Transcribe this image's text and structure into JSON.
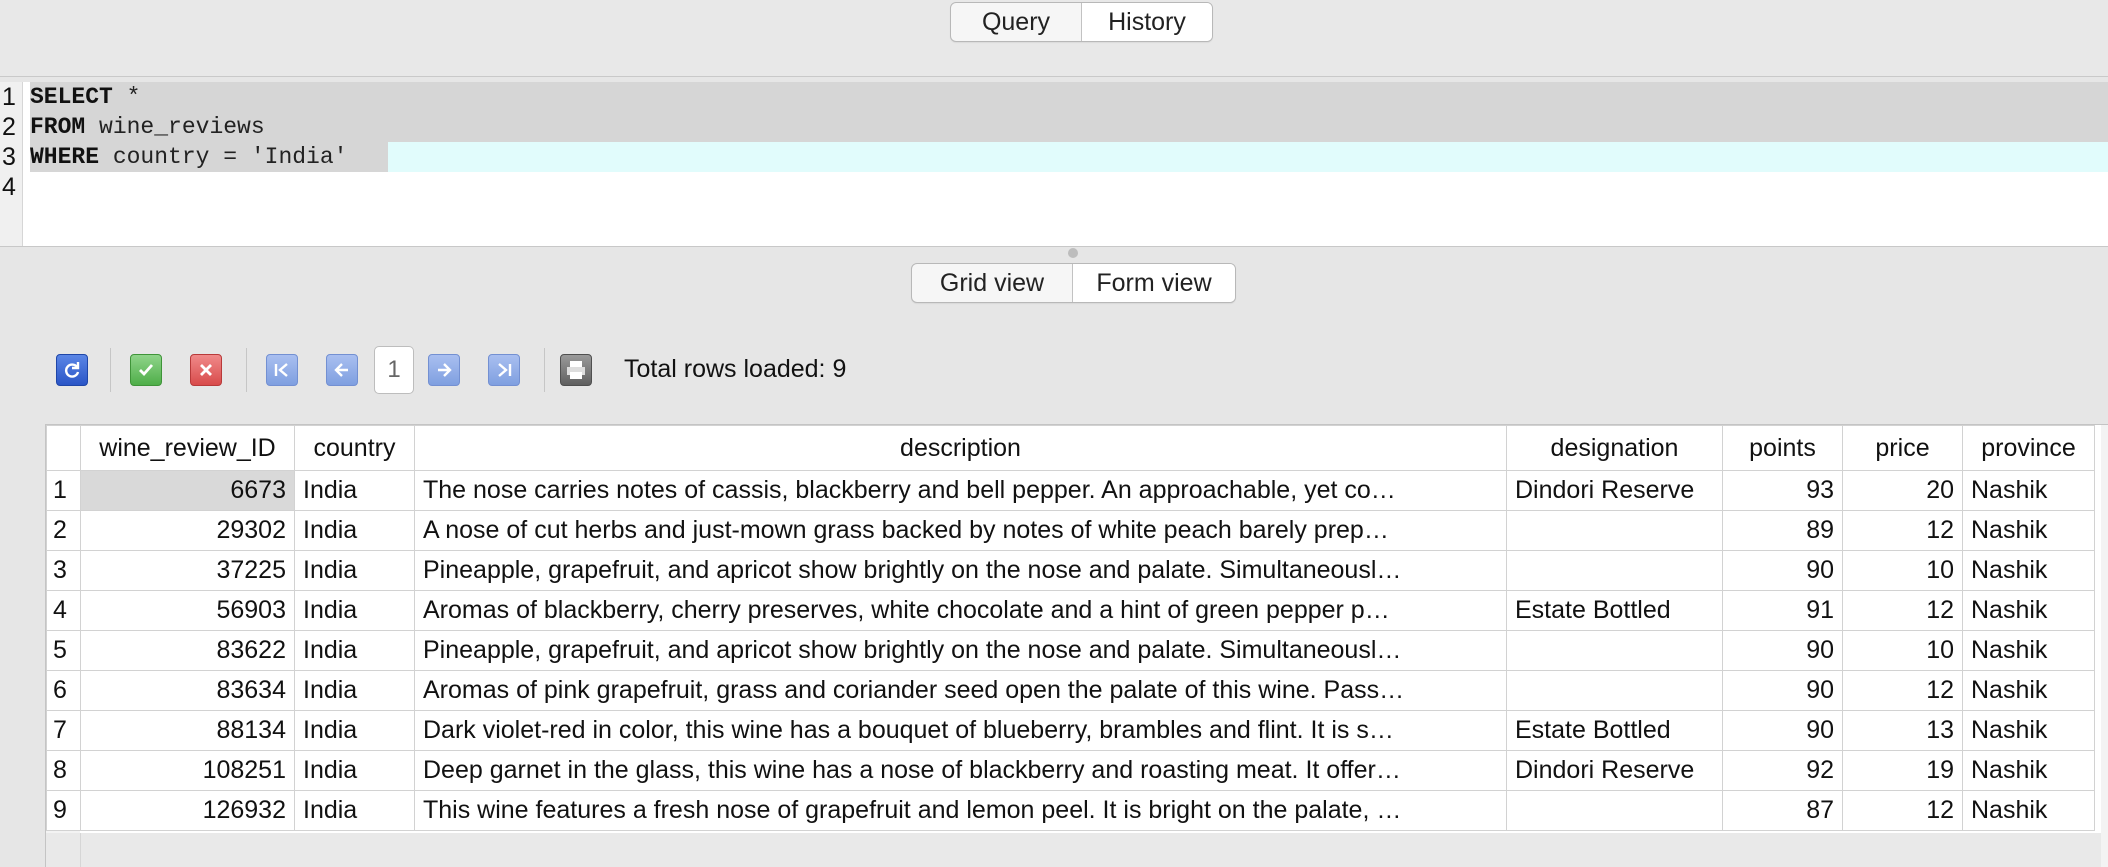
{
  "tabs": {
    "top": [
      {
        "label": "Query",
        "active": false
      },
      {
        "label": "History",
        "active": true
      }
    ],
    "view": [
      {
        "label": "Grid view",
        "active": false
      },
      {
        "label": "Form view",
        "active": true
      }
    ]
  },
  "editor": {
    "lines": [
      {
        "n": "1",
        "keyword": "SELECT",
        "rest": " *"
      },
      {
        "n": "2",
        "keyword": "FROM",
        "rest": " wine_reviews"
      },
      {
        "n": "3",
        "keyword": "WHERE",
        "rest": " country = 'India'"
      },
      {
        "n": "4",
        "keyword": "",
        "rest": ""
      }
    ]
  },
  "toolbar": {
    "page": "1",
    "total_rows_label": "Total rows loaded: 9"
  },
  "grid": {
    "columns": [
      "wine_review_ID",
      "country",
      "description",
      "designation",
      "points",
      "price",
      "province"
    ],
    "rows": [
      {
        "n": "1",
        "id": "6673",
        "country": "India",
        "description": "The nose carries notes of cassis, blackberry and bell pepper. An approachable, yet co…",
        "designation": "Dindori Reserve",
        "points": "93",
        "price": "20",
        "province": "Nashik"
      },
      {
        "n": "2",
        "id": "29302",
        "country": "India",
        "description": "A nose of cut herbs and just-mown grass backed by notes of white peach barely prep…",
        "designation": "",
        "points": "89",
        "price": "12",
        "province": "Nashik"
      },
      {
        "n": "3",
        "id": "37225",
        "country": "India",
        "description": "Pineapple, grapefruit, and apricot show brightly on the nose and palate. Simultaneousl…",
        "designation": "",
        "points": "90",
        "price": "10",
        "province": "Nashik"
      },
      {
        "n": "4",
        "id": "56903",
        "country": "India",
        "description": "Aromas of blackberry, cherry preserves, white chocolate and a hint of green pepper p…",
        "designation": "Estate Bottled",
        "points": "91",
        "price": "12",
        "province": "Nashik"
      },
      {
        "n": "5",
        "id": "83622",
        "country": "India",
        "description": "Pineapple, grapefruit, and apricot show brightly on the nose and palate. Simultaneousl…",
        "designation": "",
        "points": "90",
        "price": "10",
        "province": "Nashik"
      },
      {
        "n": "6",
        "id": "83634",
        "country": "India",
        "description": "Aromas of pink grapefruit, grass and coriander seed open the palate of this wine. Pass…",
        "designation": "",
        "points": "90",
        "price": "12",
        "province": "Nashik"
      },
      {
        "n": "7",
        "id": "88134",
        "country": "India",
        "description": "Dark violet-red in color, this wine has a bouquet of blueberry, brambles and flint. It is s…",
        "designation": "Estate Bottled",
        "points": "90",
        "price": "13",
        "province": "Nashik"
      },
      {
        "n": "8",
        "id": "108251",
        "country": "India",
        "description": "Deep garnet in the glass, this wine has a nose of blackberry and roasting meat. It offer…",
        "designation": "Dindori Reserve",
        "points": "92",
        "price": "19",
        "province": "Nashik"
      },
      {
        "n": "9",
        "id": "126932",
        "country": "India",
        "description": "This wine features a fresh nose of grapefruit and lemon peel. It is bright on the palate, …",
        "designation": "",
        "points": "87",
        "price": "12",
        "province": "Nashik"
      }
    ]
  },
  "colors": {
    "accent_blue": "#2a55c6",
    "ok_green": "#4fae49",
    "cancel_red": "#d84b4b",
    "current_line": "#e1fcfc",
    "selection": "#d6d6d6"
  },
  "icons": {
    "refresh": "refresh-icon",
    "commit": "checkmark-icon",
    "rollback": "close-icon",
    "first": "first-page-icon",
    "prev": "previous-page-icon",
    "next": "next-page-icon",
    "last": "last-page-icon",
    "print": "print-icon"
  }
}
